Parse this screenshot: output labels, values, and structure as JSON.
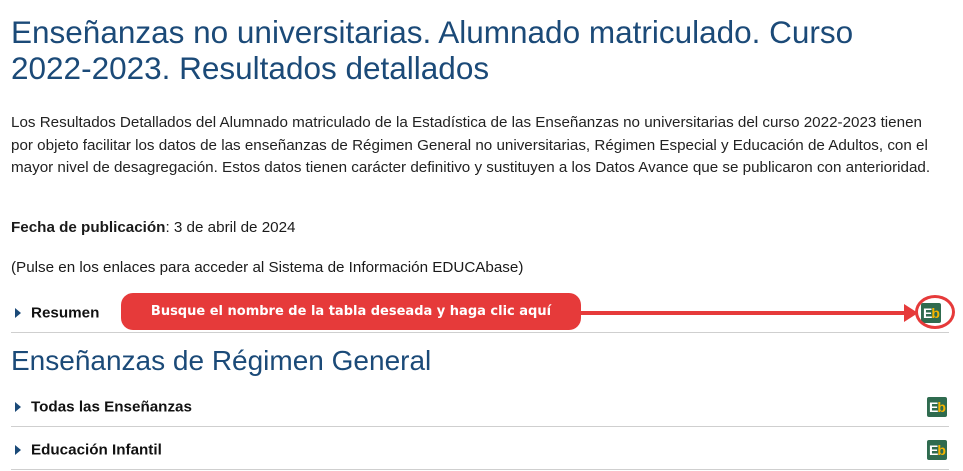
{
  "page": {
    "title": "Enseñanzas no universitarias. Alumnado matriculado. Curso 2022-2023. Resultados detallados",
    "intro": "Los Resultados Detallados del Alumnado matriculado de la Estadística de las Enseñanzas no universitarias del curso 2022-2023 tienen por objeto facilitar los datos de las enseñanzas de Régimen General no universitarias, Régimen Especial y Educación de Adultos, con el mayor nivel de desagregación. Estos datos tienen carácter definitivo y sustituyen a los Datos Avance que se publicaron con anterioridad.",
    "publication_label": "Fecha de publicación",
    "publication_date": ": 3 de abril de 2024",
    "hint": "(Pulse en los enlaces para acceder al Sistema de Información EDUCAbase)"
  },
  "icon": {
    "e": "E",
    "b": "b",
    "name": "educabase-icon",
    "colors": {
      "bg": "#2f6b4f",
      "e": "#ffffff",
      "b": "#f5b400"
    }
  },
  "rows": {
    "resumen": "Resumen",
    "section_heading": "Enseñanzas de Régimen General",
    "todas": "Todas las Enseñanzas",
    "infantil": "Educación Infantil"
  },
  "callout": {
    "text": "Busque el nombre de la tabla deseada y haga clic aquí",
    "color": "#e63a3a"
  },
  "colors": {
    "heading": "#1b4a78",
    "text": "#222222"
  }
}
